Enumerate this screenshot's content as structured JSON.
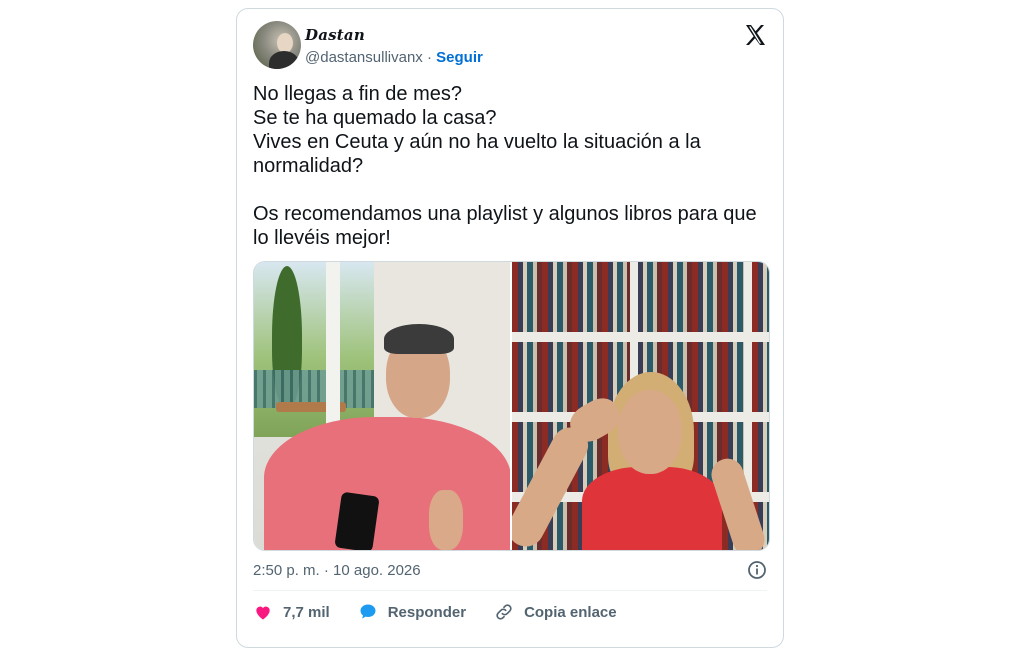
{
  "author": {
    "display_name": "Dastan",
    "handle": "@dastansullivanx",
    "separator": "·",
    "follow_label": "Seguir"
  },
  "platform_icon": "x-logo-icon",
  "tweet": {
    "lines": [
      "No llegas a fin de mes?",
      "Se te ha quemado la casa?",
      "Vives en Ceuta y aún no ha vuelto la situación a la normalidad?",
      "",
      "Os recomendamos una playlist y algunos libros para que lo llevéis mejor!"
    ]
  },
  "timestamp": "2:50 p. m. · 10 ago. 2026",
  "actions": {
    "like_count": "7,7 mil",
    "reply_label": "Responder",
    "copy_link_label": "Copia enlace"
  },
  "colors": {
    "link": "#006fd6",
    "like": "#f91880",
    "reply": "#1d9bf0",
    "muted": "#536471"
  }
}
